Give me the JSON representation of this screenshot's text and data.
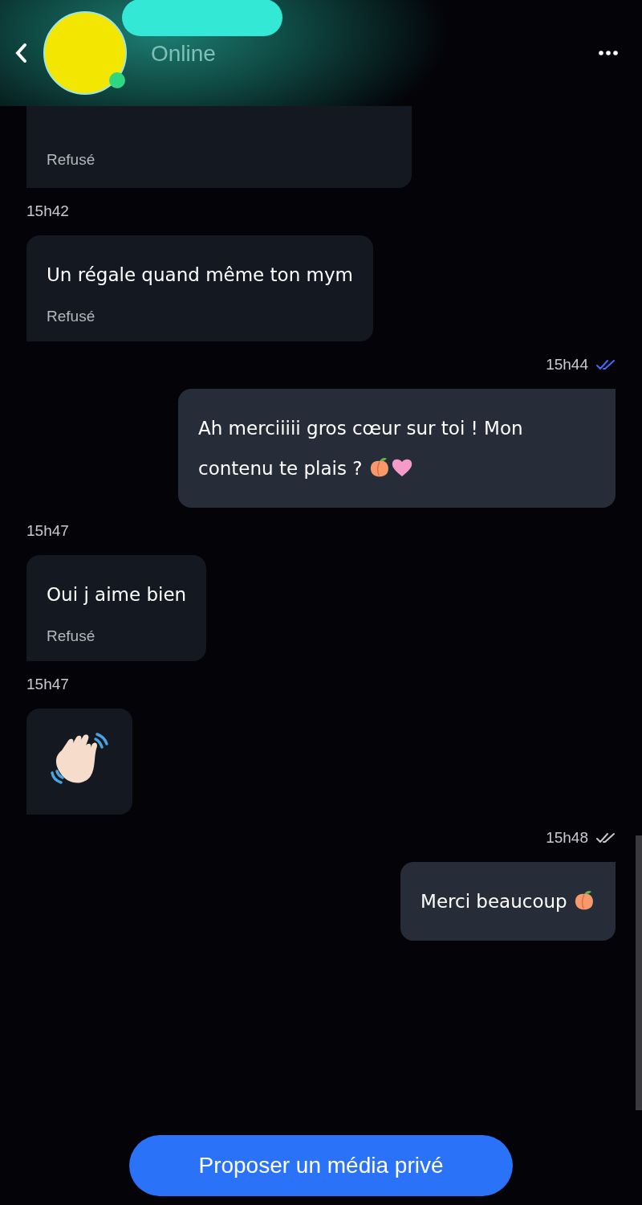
{
  "header": {
    "status": "Online",
    "online": true
  },
  "messages": [
    {
      "kind": "text",
      "sent": false,
      "cut_top": true,
      "status": "Refusé"
    },
    {
      "kind": "text",
      "sent": false,
      "time": "15h42",
      "text": "Un régale quand même ton mym",
      "status": "Refusé"
    },
    {
      "kind": "text",
      "sent": true,
      "time": "15h44",
      "read": true,
      "text": "Ah merciiiii gros cœur sur toi ! Mon contenu te plais ?",
      "emojis": [
        {
          "kind": "peach"
        },
        {
          "kind": "heart"
        }
      ]
    },
    {
      "kind": "text",
      "sent": false,
      "time": "15h47",
      "text": "Oui j aime bien",
      "status": "Refusé"
    },
    {
      "kind": "wave",
      "sent": false,
      "time": "15h47"
    },
    {
      "kind": "text",
      "sent": true,
      "time": "15h48",
      "read": false,
      "text": "Merci beaucoup",
      "emojis": [
        {
          "kind": "peach"
        }
      ]
    }
  ],
  "action_button": "Proposer un média privé"
}
